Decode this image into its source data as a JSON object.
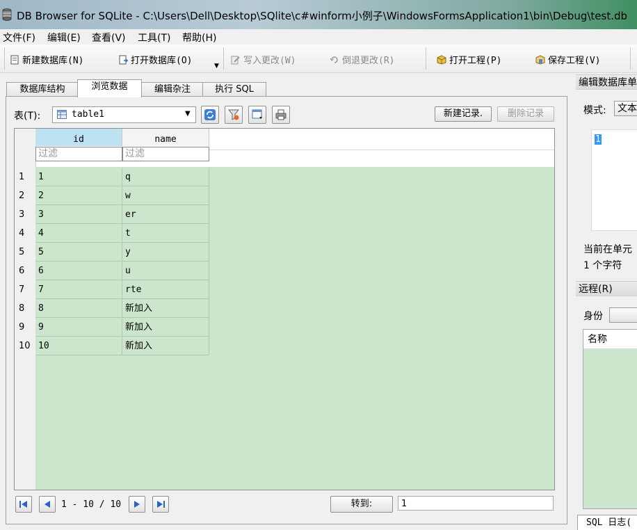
{
  "window": {
    "title": "DB Browser for SQLite - C:\\Users\\Dell\\Desktop\\SQlite\\c#winform小例子\\WindowsFormsApplication1\\bin\\Debug\\test.db"
  },
  "menu": [
    "文件(F)",
    "编辑(E)",
    "查看(V)",
    "工具(T)",
    "帮助(H)"
  ],
  "toolbar": {
    "new_db": "新建数据库(N)",
    "open_db": "打开数据库(O)",
    "write_changes": "写入更改(W)",
    "revert_changes": "倒退更改(R)",
    "open_project": "打开工程(P)",
    "save_project": "保存工程(V)"
  },
  "tabs": [
    "数据库结构",
    "浏览数据",
    "编辑杂注",
    "执行 SQL"
  ],
  "browse": {
    "table_label": "表(T):",
    "table_selected": "table1",
    "new_record": "新建记录.",
    "delete_record": "删除记录",
    "columns": [
      "id",
      "name"
    ],
    "filter_placeholder": "过滤",
    "rows": [
      {
        "n": "1",
        "id": "1",
        "name": "q"
      },
      {
        "n": "2",
        "id": "2",
        "name": "w"
      },
      {
        "n": "3",
        "id": "3",
        "name": "er"
      },
      {
        "n": "4",
        "id": "4",
        "name": "t"
      },
      {
        "n": "5",
        "id": "5",
        "name": "y"
      },
      {
        "n": "6",
        "id": "6",
        "name": "u"
      },
      {
        "n": "7",
        "id": "7",
        "name": "rte"
      },
      {
        "n": "8",
        "id": "8",
        "name": "新加入"
      },
      {
        "n": "9",
        "id": "9",
        "name": "新加入"
      },
      {
        "n": "10",
        "id": "10",
        "name": "新加入"
      }
    ],
    "page_info": "1 - 10 / 10",
    "goto_label": "转到:",
    "goto_value": "1"
  },
  "dock": {
    "edit_cell_title": "编辑数据库单",
    "mode_label": "模式:",
    "mode_value": "文本",
    "cell_value": "1",
    "current_cell": "当前在单元",
    "char_count": "1 个字符",
    "remote_title": "远程(R)",
    "identity_label": "身份",
    "name_col": "名称",
    "sql_log_tab": "SQL 日志("
  },
  "colors": {
    "grid_bg": "#cce6cd",
    "header_highlight": "#bde3f3"
  }
}
